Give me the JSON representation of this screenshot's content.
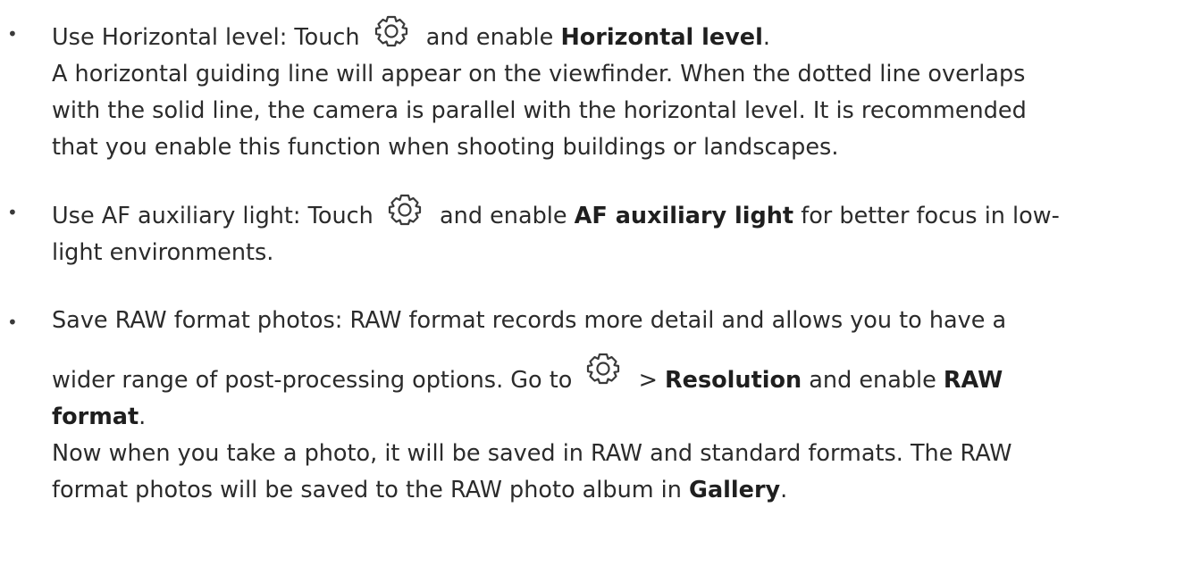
{
  "items": [
    {
      "bullet": "•",
      "text_before_icon": "Use Horizontal level: Touch",
      "icon": "settings-gear-icon",
      "text_after_icon": "and enable",
      "bold": "Horizontal level",
      "end": ".",
      "description_lines": [
        "A horizontal guiding line will appear on the viewfinder. When the dotted line overlaps",
        "with the solid line, the camera is parallel with the horizontal level. It is recommended",
        "that you enable this function when shooting buildings or landscapes."
      ]
    },
    {
      "bullet": "•",
      "text_before_icon": "Use AF auxiliary light: Touch",
      "icon": "settings-gear-icon",
      "text_after_icon": "and enable",
      "bold": "AF auxiliary light",
      "end_line1": "for better focus in low-",
      "end_line2": "light environments."
    },
    {
      "bullet": "•",
      "line1": "Save RAW format photos: RAW format records more detail and allows you to have a",
      "line2_before_icon": "wider range of post-processing options. Go to",
      "icon": "settings-gear-icon",
      "arrow": ">",
      "bold_resolution": "Resolution",
      "and_enable": "and enable",
      "bold_raw": "RAW",
      "bold_format": "format",
      "period": ".",
      "description_lines": [
        "Now when you take a photo, it will be saved in RAW and standard formats. The RAW",
        "format photos will be saved to the RAW photo album in"
      ],
      "bold_gallery": "Gallery",
      "final_period": "."
    }
  ]
}
